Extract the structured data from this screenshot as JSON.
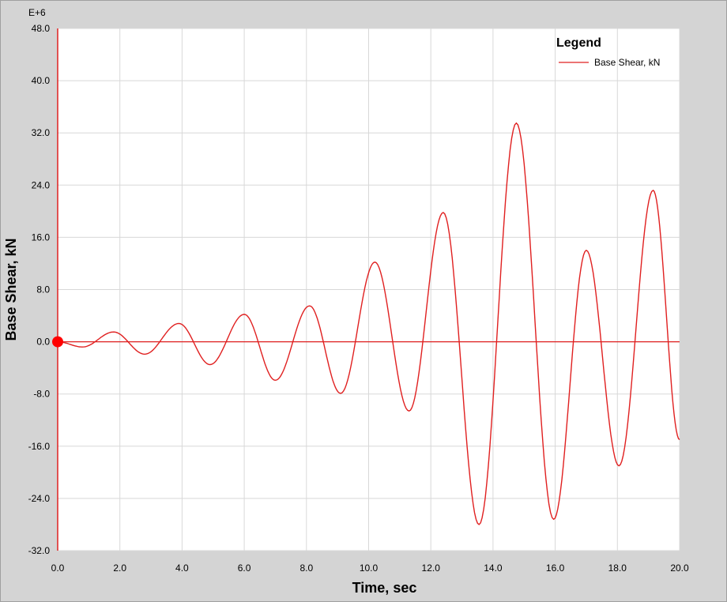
{
  "chart_data": {
    "type": "line",
    "xlabel": "Time,  sec",
    "ylabel": "Base Shear,  kN",
    "y_multiplier": "E+6",
    "xlim": [
      0,
      20
    ],
    "ylim": [
      -32,
      48
    ],
    "x_ticks": [
      "0.0",
      "2.0",
      "4.0",
      "6.0",
      "8.0",
      "10.0",
      "12.0",
      "14.0",
      "16.0",
      "18.0",
      "20.0"
    ],
    "y_ticks": [
      "48.0",
      "40.0",
      "32.0",
      "24.0",
      "16.0",
      "8.0",
      "0.0",
      "-8.0",
      "-16.0",
      "-24.0",
      "-32.0"
    ],
    "grid": true,
    "legend": {
      "title": "Legend",
      "placement": "top-right"
    },
    "colors": {
      "series": "#e02020",
      "marker": "#ff0000",
      "grid": "#d8d8d8",
      "plot_bg": "#ffffff"
    },
    "marker": {
      "x": 0,
      "y": 0
    },
    "series": [
      {
        "name": "Base Shear, kN",
        "points": [
          [
            0.0,
            0.0
          ],
          [
            0.8,
            -0.8
          ],
          [
            1.8,
            1.5
          ],
          [
            2.8,
            -1.9
          ],
          [
            3.9,
            2.8
          ],
          [
            4.9,
            -3.5
          ],
          [
            6.0,
            4.2
          ],
          [
            7.0,
            -5.9
          ],
          [
            8.1,
            5.5
          ],
          [
            9.1,
            -7.9
          ],
          [
            10.2,
            12.2
          ],
          [
            11.3,
            -10.6
          ],
          [
            12.4,
            19.8
          ],
          [
            13.55,
            -28.0
          ],
          [
            14.75,
            33.5
          ],
          [
            15.95,
            -27.2
          ],
          [
            17.0,
            14.0
          ],
          [
            18.05,
            -19.0
          ],
          [
            19.15,
            23.2
          ],
          [
            20.0,
            -15.0
          ]
        ]
      }
    ]
  }
}
